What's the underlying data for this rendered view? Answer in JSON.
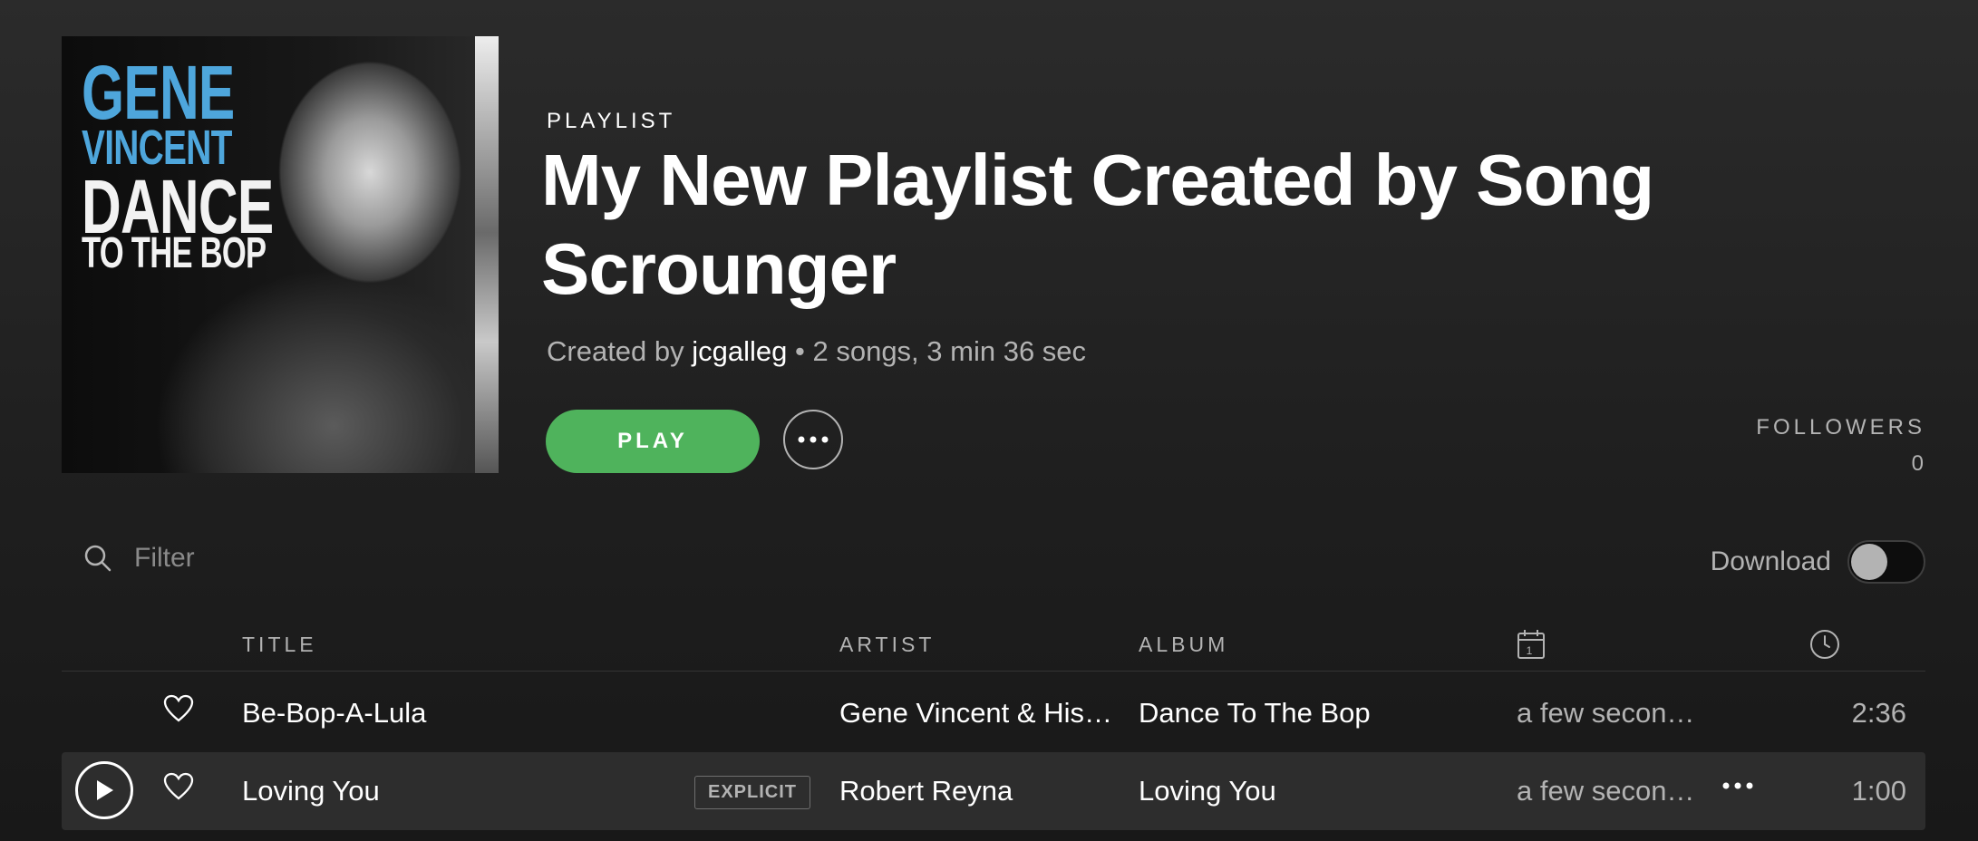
{
  "header": {
    "type_label": "PLAYLIST",
    "title": "My New Playlist Created by Song Scrounger",
    "created_by_prefix": "Created by",
    "owner": "jcgalleg",
    "summary": "• 2 songs, 3 min 36 sec",
    "cover_art": {
      "line1": "GENE",
      "line2": "VINCENT",
      "line3": "DANCE",
      "line4": "TO THE BOP"
    }
  },
  "actions": {
    "play_label": "PLAY",
    "more_icon": "more-horizontal-icon"
  },
  "followers": {
    "label": "FOLLOWERS",
    "count": "0"
  },
  "filter": {
    "placeholder": "Filter",
    "icon": "search-icon"
  },
  "download": {
    "label": "Download",
    "enabled": false
  },
  "table": {
    "columns": {
      "title": "TITLE",
      "artist": "ARTIST",
      "album": "ALBUM",
      "date_icon": "calendar-icon",
      "date_icon_text": "1",
      "duration_icon": "clock-icon"
    },
    "rows": [
      {
        "title": "Be-Bop-A-Lula",
        "artist": "Gene Vincent & His…",
        "album": "Dance To The Bop",
        "added": "a few secon…",
        "duration": "2:36",
        "explicit": false
      },
      {
        "title": "Loving You",
        "artist": "Robert Reyna",
        "album": "Loving You",
        "added": "a few secon…",
        "duration": "1:00",
        "explicit": true,
        "explicit_label": "EXPLICIT"
      }
    ]
  },
  "colors": {
    "accent": "#4fb35c",
    "text_muted": "#b3b3b3",
    "background": "#1f1f1f"
  }
}
